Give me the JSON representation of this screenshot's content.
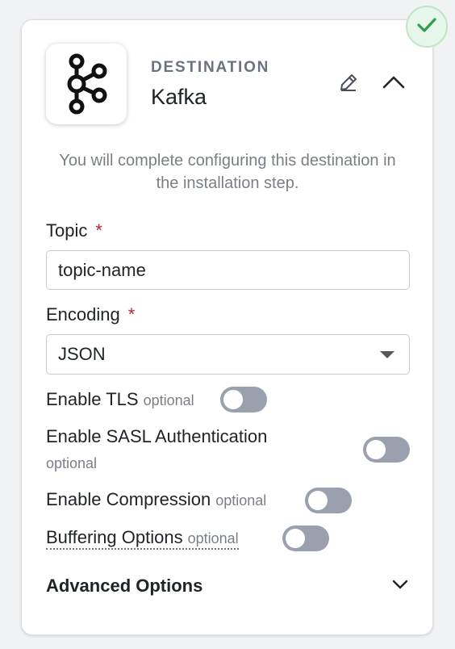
{
  "status": {
    "icon": "check-icon",
    "color": "#2e9e48"
  },
  "header": {
    "logo_icon": "kafka-logo-icon",
    "eyebrow": "DESTINATION",
    "title": "Kafka",
    "edit_icon": "pencil-icon",
    "collapse_icon": "chevron-up-icon"
  },
  "info_text": "You will complete configuring this destination in the installation step.",
  "fields": {
    "topic": {
      "label": "Topic",
      "required_mark": "*",
      "value": "topic-name"
    },
    "encoding": {
      "label": "Encoding",
      "required_mark": "*",
      "value": "JSON"
    }
  },
  "toggles": {
    "tls": {
      "label": "Enable TLS",
      "optional": "optional",
      "enabled": false
    },
    "sasl": {
      "label": "Enable SASL Authentication",
      "optional": "optional",
      "enabled": false
    },
    "compression": {
      "label": "Enable Compression",
      "optional": "optional",
      "enabled": false
    },
    "buffering": {
      "label": "Buffering Options",
      "optional": "optional",
      "enabled": false
    }
  },
  "advanced": {
    "label": "Advanced Options",
    "icon": "chevron-down-icon"
  },
  "colors": {
    "required": "#b42334",
    "toggle_off": "#9aa0ae",
    "muted": "#7a7f87"
  }
}
